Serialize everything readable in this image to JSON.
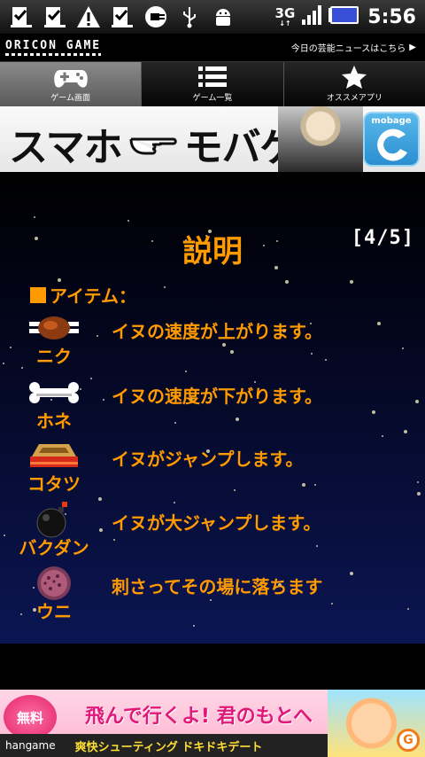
{
  "status_bar": {
    "icons": [
      "download-done-icon",
      "download-done-icon",
      "warning-icon",
      "download-done-icon",
      "plug-icon",
      "usb-icon",
      "android-icon"
    ],
    "network": "3G",
    "time": "5:56"
  },
  "brand_bar": {
    "logo": "ORICON GAME",
    "news_link": "今日の芸能ニュースはこちら"
  },
  "tabs": [
    {
      "label": "ゲーム画面",
      "icon": "gamepad-icon",
      "active": true
    },
    {
      "label": "ゲーム一覧",
      "icon": "list-icon",
      "active": false
    },
    {
      "label": "オススメアプリ",
      "icon": "star-icon",
      "active": false
    }
  ],
  "banner": {
    "left_text": "スマホ",
    "right_text": "モバゲー",
    "badge": "mobage"
  },
  "main": {
    "title": "説明",
    "page": "[4/5]",
    "section": "アイテム："
  },
  "items": [
    {
      "name": "ニク",
      "desc": "イヌの速度が上がります。",
      "icon": "meat-icon"
    },
    {
      "name": "ホネ",
      "desc": "イヌの速度が下がります。",
      "icon": "bone-icon"
    },
    {
      "name": "コタツ",
      "desc": "イヌがジャンプします。",
      "icon": "kotatsu-icon"
    },
    {
      "name": "バクダン",
      "desc": "イヌが大ジャンプします。",
      "icon": "bomb-icon"
    },
    {
      "name": "ウニ",
      "desc": "刺さってその場に落ちます",
      "icon": "sea-urchin-icon"
    }
  ],
  "ad": {
    "badge": "無料",
    "headline": "飛んで行くよ! 君のもとへ",
    "brand": "hangame",
    "subline": "爽快シューティング ドキドキデート",
    "logo": "G"
  },
  "colors": {
    "accent": "#ff9a00",
    "background_top": "#000000",
    "background_bottom": "#0b1552"
  }
}
